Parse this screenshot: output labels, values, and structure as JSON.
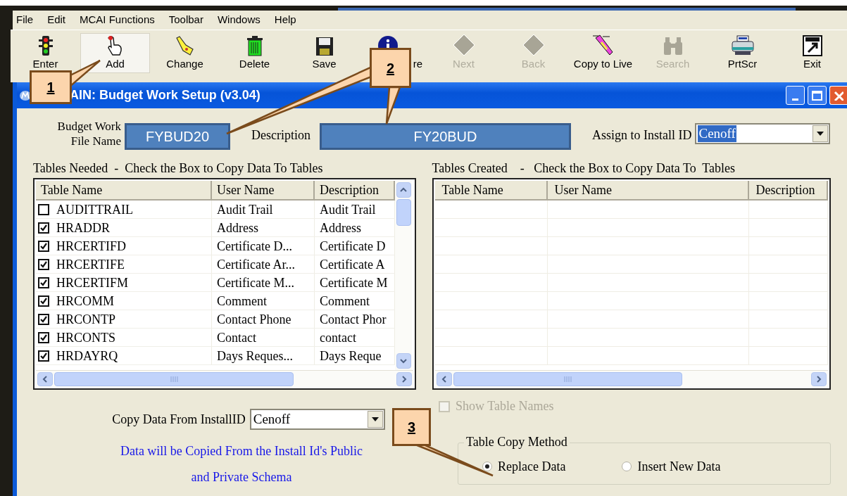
{
  "menu": [
    "File",
    "Edit",
    "MCAI Functions",
    "Toolbar",
    "Windows",
    "Help"
  ],
  "toolbar": [
    {
      "kind": "enter",
      "label": "Enter",
      "disabled": false,
      "selected": false
    },
    {
      "kind": "add",
      "label": "Add",
      "disabled": false,
      "selected": true
    },
    {
      "kind": "change",
      "label": "Change",
      "disabled": false,
      "selected": false
    },
    {
      "kind": "delete",
      "label": "Delete",
      "disabled": false,
      "selected": false
    },
    {
      "kind": "save",
      "label": "Save",
      "disabled": false,
      "selected": false
    },
    {
      "kind": "more",
      "label": "re",
      "disabled": false,
      "selected": false
    },
    {
      "kind": "next",
      "label": "Next",
      "disabled": true,
      "selected": false
    },
    {
      "kind": "back",
      "label": "Back",
      "disabled": true,
      "selected": false
    },
    {
      "kind": "copy",
      "label": "Copy to Live",
      "disabled": false,
      "selected": false
    },
    {
      "kind": "search",
      "label": "Search",
      "disabled": true,
      "selected": false
    },
    {
      "kind": "print",
      "label": "PrtScr",
      "disabled": false,
      "selected": false
    },
    {
      "kind": "exit",
      "label": "Exit",
      "disabled": false,
      "selected": false
    }
  ],
  "window": {
    "title": "AIN: Budget Work Setup (v3.04)"
  },
  "form": {
    "file_name_label": "Budget Work\nFile Name",
    "file_name": "FYBUD20",
    "description_label": "Description",
    "description": "FY20BUD",
    "install_label": "Assign to Install ID",
    "install_value": "Cenoff"
  },
  "tables_needed": {
    "heading": "Tables Needed  -  Check the Box to Copy Data To Tables",
    "columns": [
      "Table Name",
      "User Name",
      "Description"
    ],
    "rows": [
      {
        "checked": false,
        "cells": [
          "AUDITTRAIL",
          "Audit Trail",
          "Audit Trail"
        ]
      },
      {
        "checked": true,
        "cells": [
          "HRADDR",
          "Address",
          "Address"
        ]
      },
      {
        "checked": true,
        "cells": [
          "HRCERTIFD",
          "Certificate D...",
          "Certificate D"
        ]
      },
      {
        "checked": true,
        "cells": [
          "HRCERTIFE",
          "Certificate Ar...",
          "Certificate A"
        ]
      },
      {
        "checked": true,
        "cells": [
          "HRCERTIFM",
          "Certificate M...",
          "Certificate M"
        ]
      },
      {
        "checked": true,
        "cells": [
          "HRCOMM",
          "Comment",
          "Comment"
        ]
      },
      {
        "checked": true,
        "cells": [
          "HRCONTP",
          "Contact Phone",
          "Contact Phor"
        ]
      },
      {
        "checked": true,
        "cells": [
          "HRCONTS",
          "Contact",
          "contact"
        ]
      },
      {
        "checked": true,
        "cells": [
          "HRDAYRQ",
          "Days Reques...",
          "Days Reque"
        ]
      }
    ]
  },
  "tables_created": {
    "heading": "Tables Created    -   Check the Box to Copy Data To  Tables",
    "columns": [
      "Table Name",
      "User Name",
      "Description"
    ]
  },
  "show_table_names": {
    "label": "Show Table Names",
    "checked": false,
    "disabled": true
  },
  "copy_from": {
    "label": "Copy Data From InstallID",
    "value": "Cenoff"
  },
  "note": [
    "Data will be Copied From the Install Id's Public",
    "and Private Schema"
  ],
  "copy_method": {
    "title": "Table Copy Method",
    "options": [
      {
        "label": "Replace Data",
        "selected": true
      },
      {
        "label": "Insert New Data",
        "selected": false
      }
    ]
  },
  "callouts": [
    {
      "label": "1"
    },
    {
      "label": "2"
    },
    {
      "label": "3"
    }
  ]
}
